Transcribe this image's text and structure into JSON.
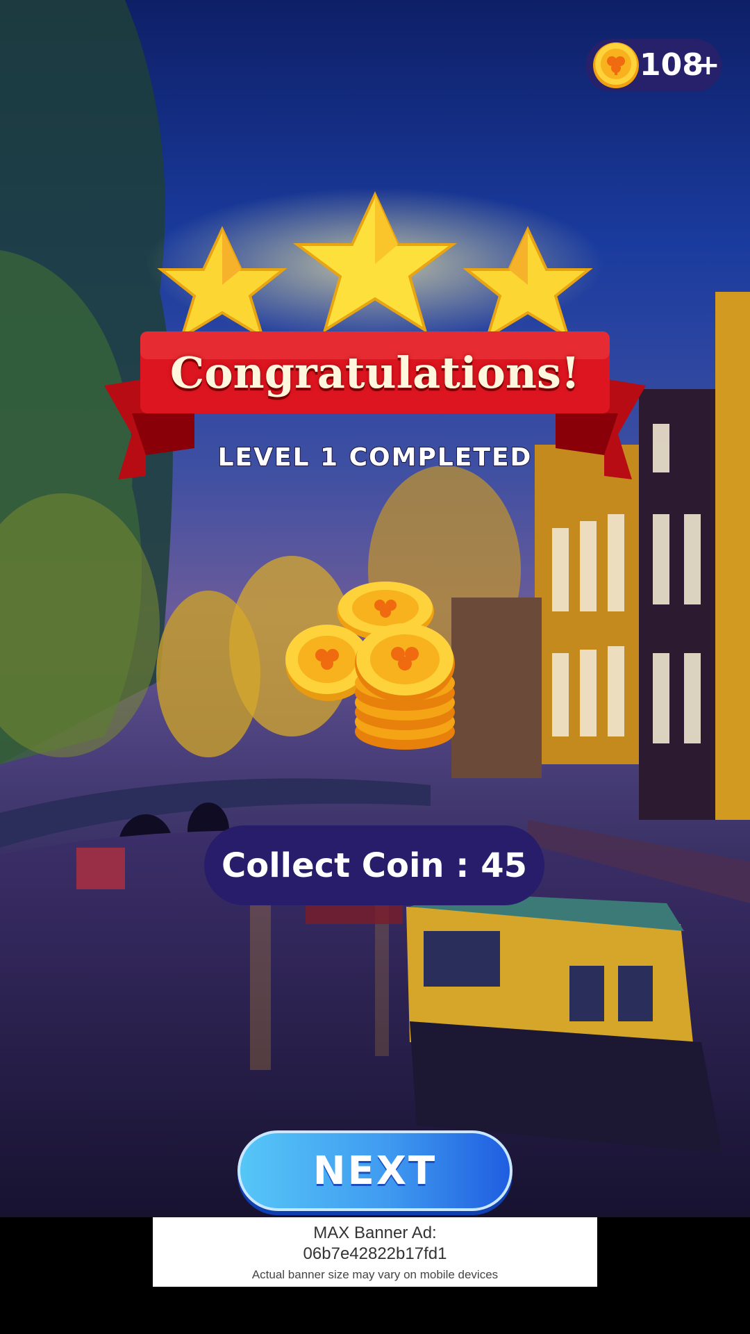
{
  "hud": {
    "coin_count": "108",
    "add_label": "+",
    "coin_icon": "clover-coin-icon"
  },
  "result": {
    "title": "Congratulations!",
    "subtitle": "LEVEL 1 COMPLETED",
    "stars_earned": 3,
    "stars_total": 3,
    "collect_label": "Collect Coin : 45"
  },
  "buttons": {
    "next_label": "NEXT"
  },
  "ad": {
    "line1": "MAX Banner Ad:",
    "line2": "06b7e42822b17fd1",
    "line3": "Actual banner size may vary on mobile devices"
  },
  "colors": {
    "star": "#fcd734",
    "ribbon": "#d8121a",
    "pill": "#271d6b",
    "next_button": "#3f9af0",
    "coin": "#f7b21e"
  }
}
